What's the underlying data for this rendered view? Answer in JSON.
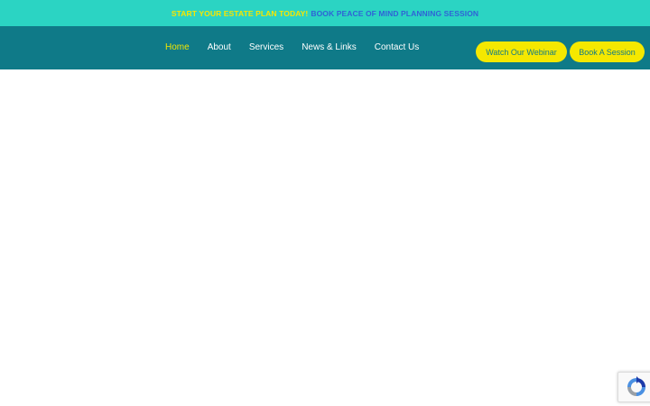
{
  "promo_bar": {
    "text": "START YOUR ESTATE PLAN TODAY!",
    "link": "BOOK PEACE OF MIND PLANNING SESSION"
  },
  "nav": {
    "items": [
      {
        "label": "Home",
        "active": true
      },
      {
        "label": "About"
      },
      {
        "label": "Services"
      },
      {
        "label": "News & Links"
      },
      {
        "label": "Contact Us"
      }
    ],
    "cta_webinar": "Watch Our Webinar",
    "cta_book": "Book A Session"
  },
  "recaptcha": {
    "icon": "recaptcha-icon"
  },
  "colors": {
    "promo_bg": "#2bd4c3",
    "nav_bg": "#0f7a88",
    "accent_yellow": "#f5e800",
    "link_blue": "#2f63d6"
  }
}
